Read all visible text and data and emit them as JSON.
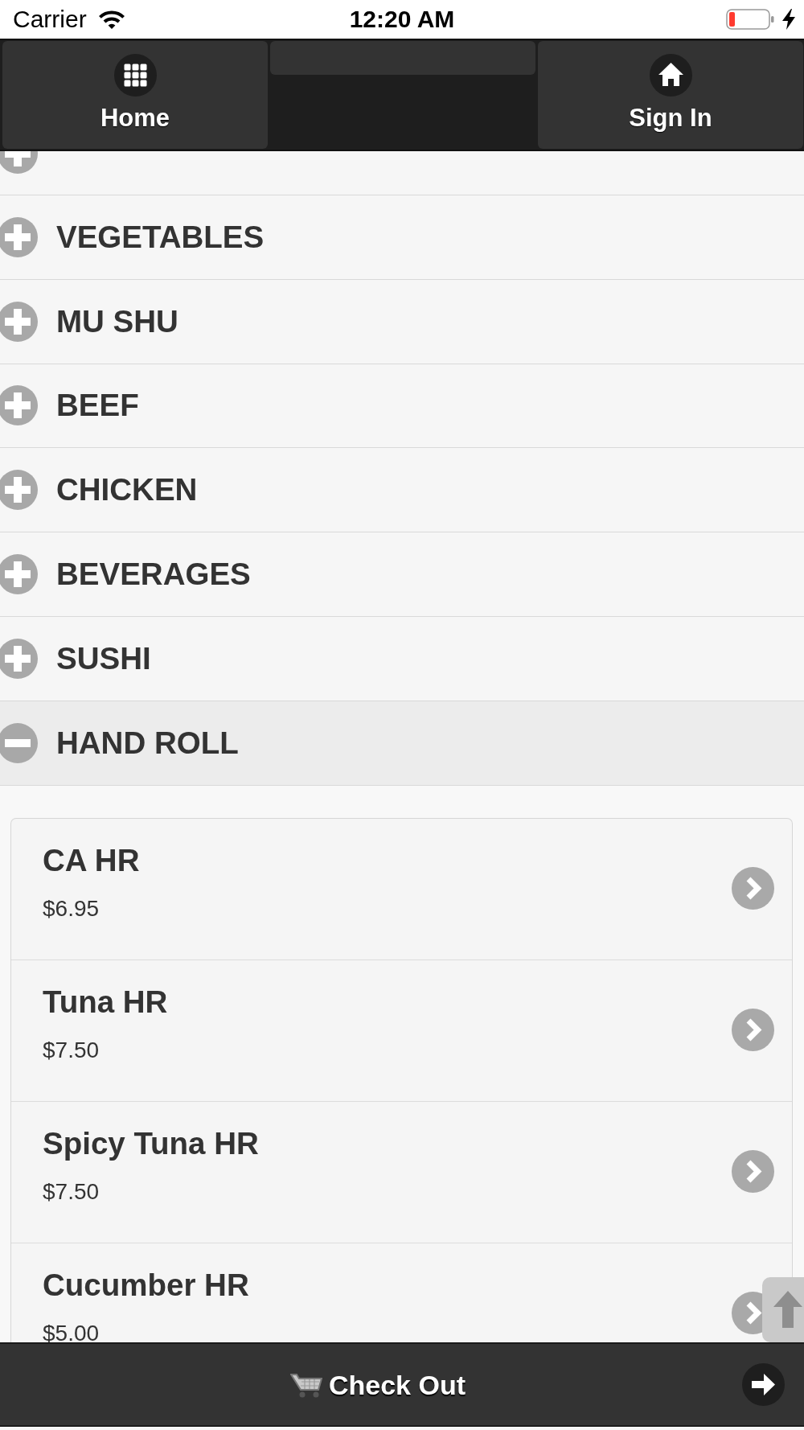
{
  "status_bar": {
    "carrier": "Carrier",
    "time": "12:20 AM"
  },
  "header": {
    "buttons": [
      {
        "kind": "grid",
        "label": "Home"
      },
      {
        "kind": "blank"
      },
      {
        "kind": "house",
        "label": "Sign In"
      }
    ]
  },
  "categories": [
    {
      "expanded": false
    },
    {
      "label": "VEGETABLES",
      "expanded": false
    },
    {
      "label": "MU SHU",
      "expanded": false
    },
    {
      "label": "BEEF",
      "expanded": false
    },
    {
      "label": "CHICKEN",
      "expanded": false
    },
    {
      "label": "BEVERAGES",
      "expanded": false
    },
    {
      "label": "SUSHI",
      "expanded": false
    },
    {
      "label": "HAND ROLL",
      "expanded": true,
      "items": [
        {
          "name": "CA HR",
          "price": "$6.95"
        },
        {
          "name": "Tuna HR",
          "price": "$7.50"
        },
        {
          "name": "Spicy Tuna HR",
          "price": "$7.50"
        },
        {
          "name": "Cucumber HR",
          "price": "$5.00"
        }
      ]
    }
  ],
  "checkout": {
    "label": "Check Out"
  }
}
